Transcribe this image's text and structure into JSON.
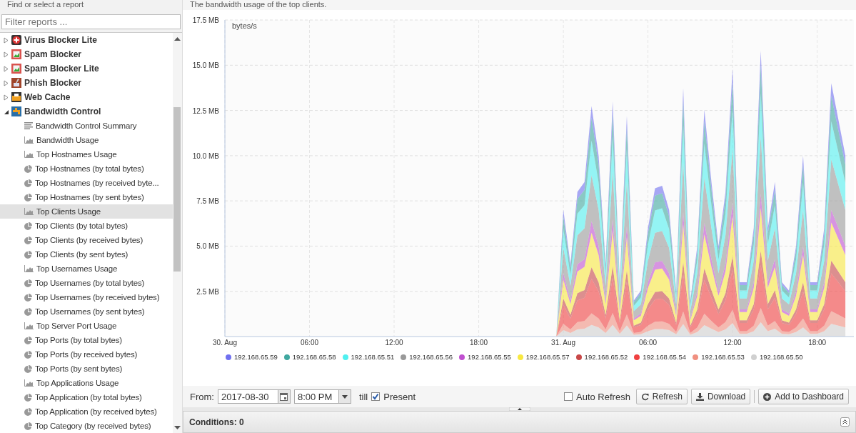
{
  "sidebar": {
    "title": "Find or select a report",
    "filter": {
      "placeholder": "Filter reports ..."
    },
    "tree": [
      {
        "label": "Virus Blocker Lite",
        "expanded": false,
        "selected": false
      },
      {
        "label": "Spam Blocker",
        "expanded": false,
        "selected": false
      },
      {
        "label": "Spam Blocker Lite",
        "expanded": false,
        "selected": false
      },
      {
        "label": "Phish Blocker",
        "expanded": false,
        "selected": false
      },
      {
        "label": "Web Cache",
        "expanded": false,
        "selected": false
      },
      {
        "label": "Bandwidth Control",
        "expanded": true,
        "selected": false,
        "children": [
          {
            "label": "Bandwidth Control Summary",
            "kind": "summary",
            "selected": false
          },
          {
            "label": "Bandwidth Usage",
            "kind": "area",
            "selected": false
          },
          {
            "label": "Top Hostnames Usage",
            "kind": "area",
            "selected": false
          },
          {
            "label": "Top Hostnames (by total bytes)",
            "kind": "pie",
            "selected": false
          },
          {
            "label": "Top Hostnames (by received byte...",
            "kind": "pie",
            "selected": false
          },
          {
            "label": "Top Hostnames (by sent bytes)",
            "kind": "pie",
            "selected": false
          },
          {
            "label": "Top Clients Usage",
            "kind": "area",
            "selected": true
          },
          {
            "label": "Top Clients (by total bytes)",
            "kind": "pie",
            "selected": false
          },
          {
            "label": "Top Clients (by received bytes)",
            "kind": "pie",
            "selected": false
          },
          {
            "label": "Top Clients (by sent bytes)",
            "kind": "pie",
            "selected": false
          },
          {
            "label": "Top Usernames Usage",
            "kind": "area",
            "selected": false
          },
          {
            "label": "Top Usernames (by total bytes)",
            "kind": "pie",
            "selected": false
          },
          {
            "label": "Top Usernames (by received bytes)",
            "kind": "pie",
            "selected": false
          },
          {
            "label": "Top Usernames (by sent bytes)",
            "kind": "pie",
            "selected": false
          },
          {
            "label": "Top Server Port Usage",
            "kind": "area",
            "selected": false
          },
          {
            "label": "Top Ports (by total bytes)",
            "kind": "pie",
            "selected": false
          },
          {
            "label": "Top Ports (by received bytes)",
            "kind": "pie",
            "selected": false
          },
          {
            "label": "Top Ports (by sent bytes)",
            "kind": "pie",
            "selected": false
          },
          {
            "label": "Top Applications Usage",
            "kind": "area",
            "selected": false
          },
          {
            "label": "Top Application (by total bytes)",
            "kind": "pie",
            "selected": false
          },
          {
            "label": "Top Application (by received bytes)",
            "kind": "pie",
            "selected": false
          },
          {
            "label": "Top Category (by received bytes)",
            "kind": "pie",
            "selected": false
          }
        ]
      }
    ]
  },
  "report": {
    "description": "The bandwidth usage of the top clients.",
    "chart_data": {
      "type": "area",
      "stacked": true,
      "grid": true,
      "ylabel": "bytes/s",
      "xlim": [
        "2017-08-30T00:00",
        "2017-08-31T20:36"
      ],
      "ylim": [
        0,
        17.5
      ],
      "x": [
        "2017-08-30T00:00",
        "2017-08-30T06:00",
        "2017-08-30T12:00",
        "2017-08-30T18:00",
        "2017-08-30T23:30",
        "2017-08-31T00:00",
        "2017-08-31T00:30",
        "2017-08-31T01:00",
        "2017-08-31T01:30",
        "2017-08-31T02:00",
        "2017-08-31T02:30",
        "2017-08-31T03:00",
        "2017-08-31T03:30",
        "2017-08-31T04:00",
        "2017-08-31T04:30",
        "2017-08-31T05:00",
        "2017-08-31T05:30",
        "2017-08-31T06:00",
        "2017-08-31T06:30",
        "2017-08-31T07:00",
        "2017-08-31T07:30",
        "2017-08-31T08:00",
        "2017-08-31T08:30",
        "2017-08-31T09:00",
        "2017-08-31T09:30",
        "2017-08-31T10:00",
        "2017-08-31T10:30",
        "2017-08-31T11:00",
        "2017-08-31T11:30",
        "2017-08-31T12:00",
        "2017-08-31T12:30",
        "2017-08-31T13:00",
        "2017-08-31T13:30",
        "2017-08-31T14:00",
        "2017-08-31T14:30",
        "2017-08-31T15:00",
        "2017-08-31T15:30",
        "2017-08-31T16:00",
        "2017-08-31T16:30",
        "2017-08-31T17:00",
        "2017-08-31T17:30",
        "2017-08-31T18:00",
        "2017-08-31T18:30",
        "2017-08-31T19:00",
        "2017-08-31T19:30",
        "2017-08-31T20:00"
      ],
      "xticks": [
        {
          "value": "2017-08-30T00:00",
          "label": "30. Aug"
        },
        {
          "value": "2017-08-30T06:00",
          "label": "06:00"
        },
        {
          "value": "2017-08-30T12:00",
          "label": "12:00"
        },
        {
          "value": "2017-08-30T18:00",
          "label": "18:00"
        },
        {
          "value": "2017-08-31T00:00",
          "label": "31. Aug"
        },
        {
          "value": "2017-08-31T06:00",
          "label": "06:00"
        },
        {
          "value": "2017-08-31T12:00",
          "label": "12:00"
        },
        {
          "value": "2017-08-31T18:00",
          "label": "18:00"
        }
      ],
      "yticks": [
        {
          "value": 2.5,
          "label": "2.5 MB"
        },
        {
          "value": 5,
          "label": "5.0 MB"
        },
        {
          "value": 7.5,
          "label": "7.5 MB"
        },
        {
          "value": 10,
          "label": "10.0 MB"
        },
        {
          "value": 12.5,
          "label": "12.5 MB"
        },
        {
          "value": 15,
          "label": "15.0 MB"
        },
        {
          "value": 17.5,
          "label": "17.5 MB"
        }
      ],
      "series": [
        {
          "name": "192.168.65.50",
          "color": "#d0d0d0",
          "values": [
            0,
            0,
            0,
            0,
            0,
            0.35,
            0.2,
            0.4,
            0.43,
            0.64,
            0.5,
            0.2,
            0.65,
            0.15,
            0.61,
            0.1,
            0.13,
            0.3,
            0.41,
            0.42,
            0.35,
            0.13,
            0.69,
            0.1,
            0.25,
            0.63,
            0.43,
            0.25,
            0.4,
            0.74,
            0.15,
            0.15,
            0.3,
            0.79,
            0.3,
            0.43,
            0.15,
            0.13,
            0.25,
            0.5,
            0.15,
            0.15,
            0.3,
            0.7,
            0.6,
            0.5
          ]
        },
        {
          "name": "192.168.65.53",
          "color": "#f09080",
          "values": [
            0,
            0,
            0,
            0,
            0,
            0.35,
            0.2,
            0.4,
            0.43,
            0.64,
            0.5,
            0.2,
            0.65,
            0.15,
            0.61,
            0.1,
            0.13,
            0.3,
            0.41,
            0.42,
            0.35,
            0.13,
            0.69,
            0.1,
            0.25,
            0.63,
            0.43,
            0.25,
            0.4,
            0.74,
            0.15,
            0.15,
            0.3,
            0.79,
            0.3,
            0.43,
            0.15,
            0.13,
            0.25,
            0.5,
            0.15,
            0.15,
            0.3,
            0.7,
            0.6,
            0.5
          ]
        },
        {
          "name": "192.168.65.54",
          "color": "#f04040",
          "values": [
            0,
            0,
            0,
            0,
            0,
            1.05,
            0.6,
            1.2,
            1.28,
            1.91,
            1.5,
            0.6,
            1.95,
            0.45,
            1.83,
            0.3,
            0.38,
            0.9,
            1.23,
            1.25,
            1.05,
            0.38,
            2.06,
            0.3,
            0.75,
            1.88,
            1.28,
            0.75,
            1.2,
            2.22,
            0.45,
            0.45,
            0.9,
            2.37,
            0.9,
            1.28,
            0.45,
            0.38,
            0.75,
            1.5,
            0.45,
            0.45,
            0.9,
            2.1,
            1.8,
            1.5
          ]
        },
        {
          "name": "192.168.65.52",
          "color": "#c84848",
          "values": [
            0,
            0,
            0,
            0,
            0,
            0.35,
            0.2,
            0.4,
            0.43,
            0.64,
            0.5,
            0.2,
            0.65,
            0.15,
            0.61,
            0.1,
            0.13,
            0.3,
            0.41,
            0.42,
            0.35,
            0.13,
            0.69,
            0.1,
            0.25,
            0.63,
            0.43,
            0.25,
            0.4,
            0.74,
            0.15,
            0.15,
            0.3,
            0.79,
            0.3,
            0.43,
            0.15,
            0.13,
            0.25,
            0.5,
            0.15,
            0.15,
            0.3,
            0.7,
            0.6,
            0.5
          ]
        },
        {
          "name": "192.168.65.57",
          "color": "#f8e840",
          "values": [
            0,
            0,
            0,
            0,
            0,
            1.05,
            0.6,
            1.2,
            1.28,
            1.91,
            1.5,
            0.6,
            1.95,
            0.45,
            1.83,
            0.3,
            0.38,
            0.9,
            1.23,
            1.25,
            1.05,
            0.38,
            2.06,
            0.3,
            0.75,
            1.88,
            1.28,
            0.75,
            1.2,
            2.22,
            0.45,
            0.45,
            0.9,
            2.37,
            0.9,
            1.28,
            0.45,
            0.38,
            0.75,
            1.5,
            0.45,
            0.45,
            0.9,
            2.1,
            1.8,
            1.5
          ]
        },
        {
          "name": "192.168.65.55",
          "color": "#c050d0",
          "values": [
            0,
            0,
            0,
            0,
            0,
            0.35,
            0.2,
            0.4,
            0.43,
            0.64,
            0.5,
            0.2,
            0.65,
            0.15,
            0.61,
            0.1,
            0.13,
            0.3,
            0.41,
            0.42,
            0.35,
            0.13,
            0.69,
            0.1,
            0.25,
            0.63,
            0.43,
            0.25,
            0.4,
            0.74,
            0.15,
            0.15,
            0.3,
            0.79,
            0.3,
            0.43,
            0.15,
            0.13,
            0.25,
            0.5,
            0.15,
            0.15,
            0.3,
            0.7,
            0.6,
            0.5
          ]
        },
        {
          "name": "192.168.65.56",
          "color": "#999999",
          "values": [
            0,
            0,
            0,
            0,
            0,
            1.4,
            0.8,
            1.6,
            1.7,
            2.54,
            2,
            0.8,
            2.6,
            0.6,
            2.44,
            0.4,
            0.5,
            1.2,
            1.64,
            1.66,
            1.4,
            0.5,
            2.74,
            0.4,
            1,
            2.5,
            1.7,
            1,
            1.6,
            2.96,
            0.6,
            0.6,
            1.2,
            3.16,
            1.2,
            1.7,
            0.6,
            0.5,
            1,
            2,
            0.6,
            0.6,
            1.2,
            2.8,
            2.4,
            2
          ]
        },
        {
          "name": "192.168.65.51",
          "color": "#50f0f0",
          "values": [
            0,
            0,
            0,
            0,
            0,
            1.05,
            0.6,
            1.2,
            1.28,
            1.91,
            1.5,
            0.6,
            1.95,
            0.45,
            1.83,
            0.3,
            0.38,
            0.9,
            1.23,
            1.25,
            1.05,
            0.38,
            2.06,
            0.3,
            0.75,
            1.88,
            1.28,
            0.75,
            1.2,
            2.22,
            0.45,
            0.45,
            0.9,
            2.37,
            0.9,
            1.28,
            0.45,
            0.38,
            0.75,
            1.5,
            0.45,
            0.45,
            0.9,
            2.1,
            1.8,
            1.5
          ]
        },
        {
          "name": "192.168.65.58",
          "color": "#40a8a0",
          "values": [
            0,
            0,
            0,
            0,
            0,
            0.7,
            0.4,
            0.8,
            0.85,
            1.27,
            1,
            0.4,
            1.3,
            0.3,
            1.22,
            0.2,
            0.25,
            0.6,
            0.82,
            0.83,
            0.7,
            0.25,
            1.37,
            0.2,
            0.5,
            1.25,
            0.85,
            0.5,
            0.8,
            1.48,
            0.3,
            0.3,
            0.6,
            1.58,
            0.6,
            0.85,
            0.3,
            0.25,
            0.5,
            1,
            0.3,
            0.3,
            0.6,
            1.4,
            1.2,
            1
          ]
        },
        {
          "name": "192.168.65.59",
          "color": "#7070f0",
          "values": [
            0,
            0,
            0,
            0,
            0,
            0.35,
            0.2,
            0.4,
            0.43,
            0.64,
            0.5,
            0.2,
            0.65,
            0.15,
            0.61,
            0.1,
            0.13,
            0.3,
            0.41,
            0.42,
            0.35,
            0.13,
            0.69,
            0.1,
            0.25,
            0.63,
            0.43,
            0.25,
            0.4,
            0.74,
            0.15,
            0.15,
            0.3,
            0.79,
            0.3,
            0.43,
            0.15,
            0.13,
            0.25,
            0.5,
            0.15,
            0.15,
            0.3,
            0.7,
            0.6,
            0.5
          ]
        }
      ]
    }
  },
  "toolbar": {
    "from_label": "From:",
    "date": "2017-08-30",
    "time": "8:00 PM",
    "till_label": "till",
    "present": {
      "label": "Present",
      "checked": true
    },
    "auto_refresh": {
      "label": "Auto Refresh",
      "checked": false
    },
    "buttons": [
      {
        "label": "Refresh",
        "kind": "refresh"
      },
      {
        "label": "Download",
        "kind": "download"
      },
      {
        "label": "Add to Dashboard",
        "kind": "add"
      }
    ]
  },
  "conditions": {
    "label": "Conditions: 0"
  }
}
